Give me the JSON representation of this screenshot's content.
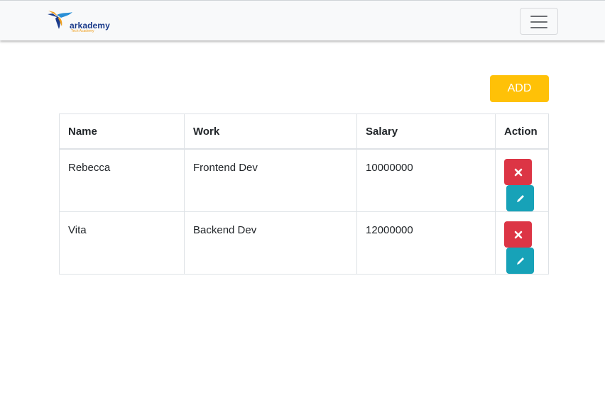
{
  "navbar": {
    "brand_name": "arkademy",
    "brand_tagline": "Tech Academy",
    "logo_icon": "hummingbird-logo",
    "toggler_icon": "hamburger-menu-icon"
  },
  "add_button_label": "ADD",
  "table": {
    "headers": [
      "Name",
      "Work",
      "Salary",
      "Action"
    ],
    "rows": [
      {
        "name": "Rebecca",
        "work": "Frontend Dev",
        "salary": "10000000"
      },
      {
        "name": "Vita",
        "work": "Backend Dev",
        "salary": "12000000"
      }
    ],
    "delete_icon": "times-icon",
    "edit_icon": "pencil-icon"
  },
  "colors": {
    "add": "#ffc107",
    "delete": "#dc3545",
    "edit": "#17a2b8",
    "navbar_bg": "#f8f9fa"
  }
}
